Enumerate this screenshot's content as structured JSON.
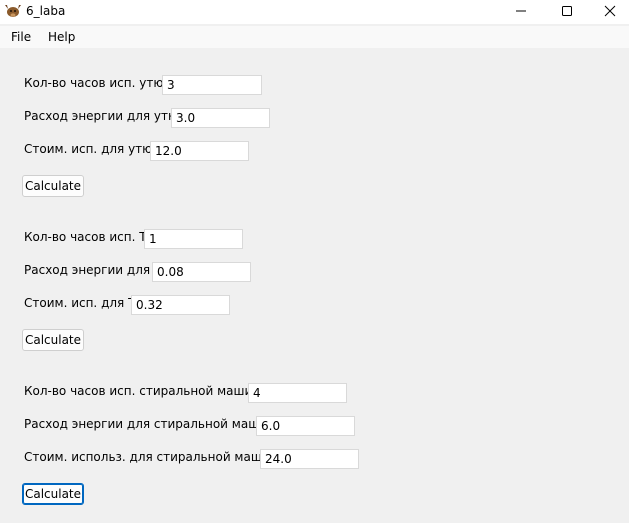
{
  "window": {
    "title": "6_laba"
  },
  "menu": {
    "file": "File",
    "help": "Help"
  },
  "iron": {
    "hours_label": "Кол-во часов исп. утюга",
    "hours_value": "3",
    "energy_label": "Расход энергии для утюга",
    "energy_value": "3.0",
    "cost_label": "Стоим. исп. для утюга",
    "cost_value": "12.0",
    "button": "Calculate"
  },
  "tv": {
    "hours_label": "Кол-во часов исп. ТВ",
    "hours_value": "1",
    "energy_label": "Расход энергии для ТВ",
    "energy_value": "0.08",
    "cost_label": "Стоим. исп. для ТВ",
    "cost_value": "0.32",
    "button": "Calculate"
  },
  "washer": {
    "hours_label": "Кол-во часов исп. стиральной машины",
    "hours_value": "4",
    "energy_label": "Расход энергии для стиральной машины",
    "energy_value": "6.0",
    "cost_label": "Стоим. использ. для стиральной машины",
    "cost_value": "24.0",
    "button": "Calculate"
  },
  "colors": {
    "focus": "#0067c0",
    "window_bg": "#f0f0f0"
  },
  "icons": [
    "app-icon",
    "minimize-icon",
    "maximize-icon",
    "close-icon"
  ]
}
